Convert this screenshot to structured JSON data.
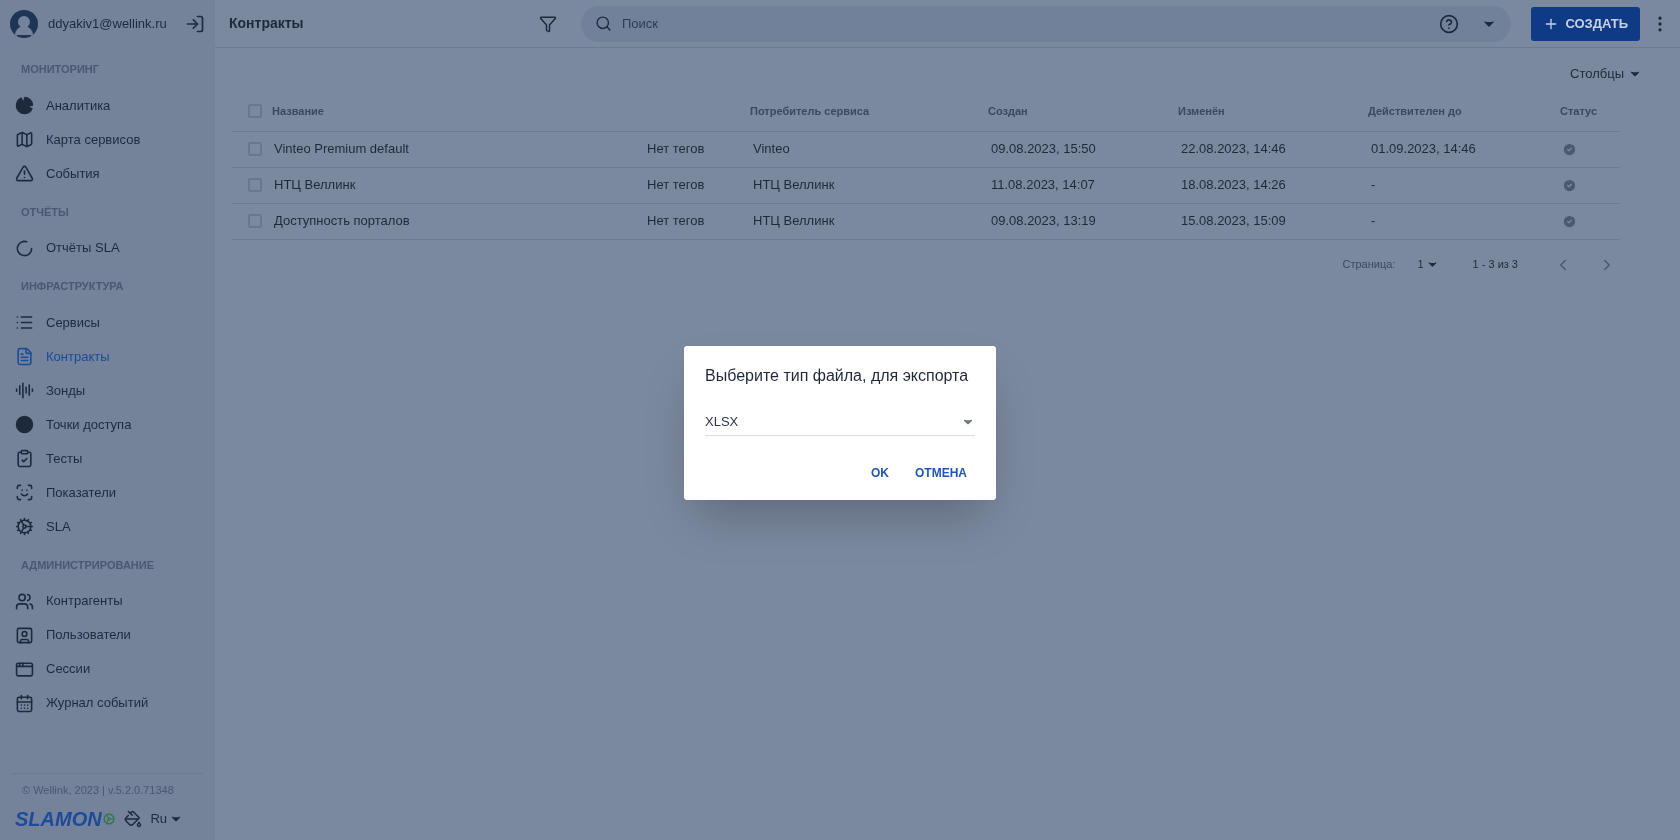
{
  "user": {
    "email": "ddyakiv1@wellink.ru"
  },
  "sidebar": {
    "sections": [
      {
        "title": "МОНИТОРИНГ",
        "items": [
          {
            "label": "Аналитика",
            "selected": false
          },
          {
            "label": "Карта сервисов",
            "selected": false
          },
          {
            "label": "События",
            "selected": false
          }
        ]
      },
      {
        "title": "ОТЧЁТЫ",
        "items": [
          {
            "label": "Отчёты SLA",
            "selected": false
          }
        ]
      },
      {
        "title": "ИНФРАСТРУКТУРА",
        "items": [
          {
            "label": "Сервисы",
            "selected": false
          },
          {
            "label": "Контракты",
            "selected": true
          },
          {
            "label": "Зонды",
            "selected": false
          },
          {
            "label": "Точки доступа",
            "selected": false
          },
          {
            "label": "Тесты",
            "selected": false
          },
          {
            "label": "Показатели",
            "selected": false
          },
          {
            "label": "SLA",
            "selected": false
          }
        ]
      },
      {
        "title": "АДМИНИСТРИРОВАНИЕ",
        "items": [
          {
            "label": "Контрагенты",
            "selected": false
          },
          {
            "label": "Пользователи",
            "selected": false
          },
          {
            "label": "Сессии",
            "selected": false
          },
          {
            "label": "Журнал событий",
            "selected": false
          }
        ]
      }
    ]
  },
  "footer": {
    "copyright": "© Wellink, 2023 | v.5.2.0.71348",
    "logo": "SLAMON",
    "language": "Ru"
  },
  "header": {
    "title": "Контракты",
    "search": {
      "placeholder": "Поиск"
    },
    "create_button": "СОЗДАТЬ"
  },
  "columns_button": "Столбцы",
  "table": {
    "header_checked": false,
    "columns": [
      "Название",
      "Потребитель сервиса",
      "Создан",
      "Изменён",
      "Действителен до",
      "Статус"
    ],
    "rows": [
      {
        "checked": false,
        "name": "Vinteo Premium default",
        "tags": "Нет тегов",
        "consumer": "Vinteo",
        "created": "09.08.2023, 15:50",
        "modified": "22.08.2023, 14:46",
        "valid_until": "01.09.2023, 14:46",
        "status_ok": true
      },
      {
        "checked": false,
        "name": "НТЦ Веллинк",
        "tags": "Нет тегов",
        "consumer": "НТЦ Веллинк",
        "created": "11.08.2023, 14:07",
        "modified": "18.08.2023, 14:26",
        "valid_until": "-",
        "status_ok": true
      },
      {
        "checked": false,
        "name": "Доступность порталов",
        "tags": "Нет тегов",
        "consumer": "НТЦ Веллинк",
        "created": "09.08.2023, 13:19",
        "modified": "15.08.2023, 15:09",
        "valid_until": "-",
        "status_ok": true
      }
    ]
  },
  "pagination": {
    "label": "Страница:",
    "page": "1",
    "range": "1 - 3 из 3"
  },
  "dialog": {
    "title": "Выберите тип файла, для экспорта",
    "select": {
      "value": "XLSX"
    },
    "buttons": [
      "OK",
      "ОТМЕНА"
    ]
  }
}
